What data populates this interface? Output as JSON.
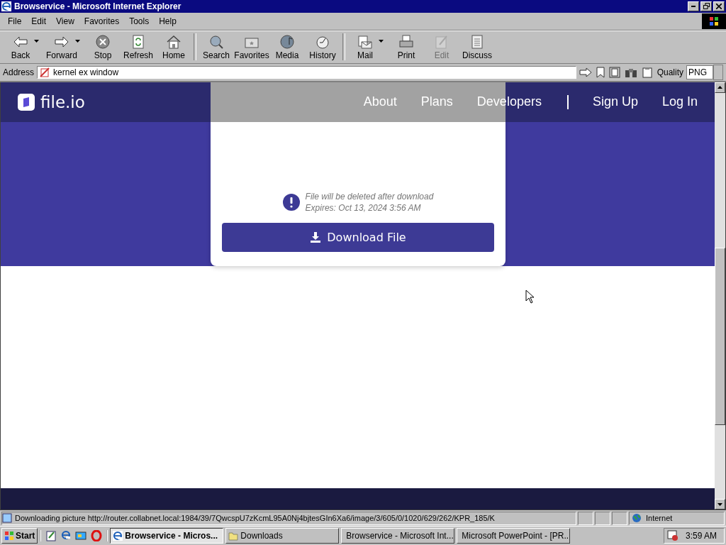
{
  "window": {
    "title": "Browservice - Microsoft Internet Explorer"
  },
  "menu": [
    {
      "label": "File"
    },
    {
      "label": "Edit"
    },
    {
      "label": "View"
    },
    {
      "label": "Favorites"
    },
    {
      "label": "Tools"
    },
    {
      "label": "Help"
    }
  ],
  "toolbar": [
    [
      {
        "label": "Back",
        "dropdown": true,
        "disabled": false
      },
      {
        "label": "Forward",
        "dropdown": true,
        "disabled": false
      },
      {
        "label": "Stop",
        "dropdown": false,
        "disabled": false
      },
      {
        "label": "Refresh",
        "dropdown": false,
        "disabled": false
      },
      {
        "label": "Home",
        "dropdown": false,
        "disabled": false
      }
    ],
    [
      {
        "label": "Search",
        "dropdown": false,
        "disabled": false
      },
      {
        "label": "Favorites",
        "dropdown": false,
        "disabled": false
      },
      {
        "label": "Media",
        "dropdown": false,
        "disabled": false
      },
      {
        "label": "History",
        "dropdown": false,
        "disabled": false
      }
    ],
    [
      {
        "label": "Mail",
        "dropdown": true,
        "disabled": false
      },
      {
        "label": "Print",
        "dropdown": false,
        "disabled": false
      },
      {
        "label": "Edit",
        "dropdown": false,
        "disabled": true
      },
      {
        "label": "Discuss",
        "dropdown": false,
        "disabled": false
      }
    ]
  ],
  "address": {
    "label": "Address",
    "value": "kernel ex window",
    "quality_label": "Quality",
    "quality_value": "PNG"
  },
  "site": {
    "logo": "file.io",
    "nav": [
      {
        "label": "About"
      },
      {
        "label": "Plans"
      },
      {
        "label": "Developers"
      },
      {
        "label": "Sign Up"
      },
      {
        "label": "Log In"
      }
    ],
    "notice": [
      "File will be deleted after download",
      "Expires: Oct 13, 2024 3:56 AM"
    ],
    "download_button": "Download File"
  },
  "status_bar": {
    "text": "Downloading picture http://router.collabnet.local:1984/39/7QwcspU7zKcmL95A0Nj4bjtesGIn6Xa6/image/3/605/0/1020/629/262/KPR_185/K",
    "zone": "Internet"
  },
  "taskbar": {
    "start": "Start",
    "tasks": [
      {
        "label": "Browservice - Micros...",
        "kind": "browser",
        "selected": true
      },
      {
        "label": "Downloads",
        "kind": "folder",
        "selected": false
      },
      {
        "label": "Browservice - Microsoft Int...",
        "kind": "browser",
        "selected": false
      },
      {
        "label": "Microsoft PowerPoint - [PR...",
        "kind": "presentation",
        "selected": false
      }
    ],
    "clock": "3:59 AM"
  }
}
